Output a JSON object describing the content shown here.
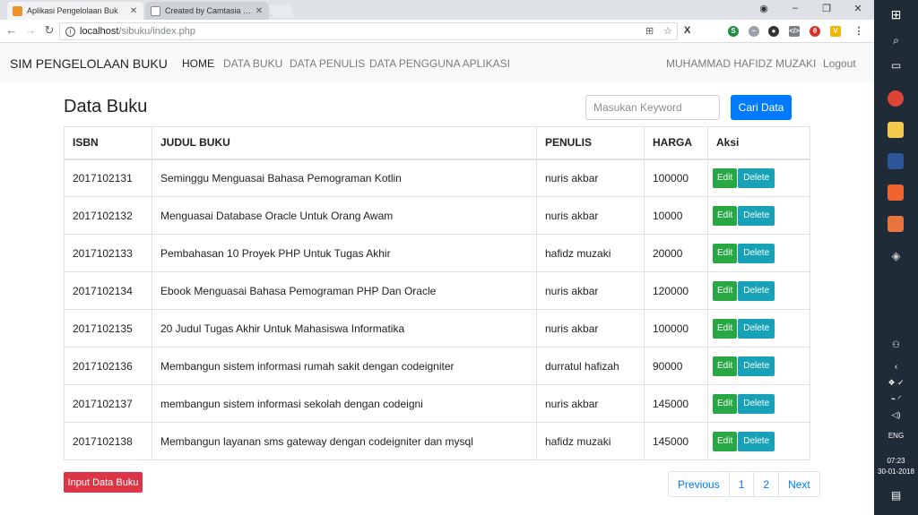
{
  "browser": {
    "tabs": [
      {
        "title": "Aplikasi Pengelolaan Buk",
        "active": true
      },
      {
        "title": "Created by Camtasia Stu",
        "active": false
      }
    ],
    "url_host": "localhost",
    "url_path": "/sibuku/index.php"
  },
  "navbar": {
    "brand": "SIM PENGELOLAAN BUKU",
    "links": [
      "HOME",
      "DATA BUKU",
      "DATA PENULIS",
      "DATA PENGGUNA APLIKASI"
    ],
    "user": "MUHAMMAD HAFIDZ MUZAKI",
    "logout": "Logout"
  },
  "main": {
    "heading": "Data Buku",
    "search_placeholder": "Masukan Keyword",
    "search_button": "Cari Data",
    "input_button": "Input Data Buku"
  },
  "table": {
    "headers": [
      "ISBN",
      "JUDUL BUKU",
      "PENULIS",
      "HARGA",
      "Aksi"
    ],
    "rows": [
      {
        "isbn": "2017102131",
        "judul": "Seminggu Menguasai Bahasa Pemograman Kotlin",
        "penulis": "nuris akbar",
        "harga": "100000"
      },
      {
        "isbn": "2017102132",
        "judul": "Menguasai Database Oracle Untuk Orang Awam",
        "penulis": "nuris akbar",
        "harga": "10000"
      },
      {
        "isbn": "2017102133",
        "judul": "Pembahasan 10 Proyek PHP Untuk Tugas Akhir",
        "penulis": "hafidz muzaki",
        "harga": "20000"
      },
      {
        "isbn": "2017102134",
        "judul": "Ebook Menguasai Bahasa Pemograman PHP Dan Oracle",
        "penulis": "nuris akbar",
        "harga": "120000"
      },
      {
        "isbn": "2017102135",
        "judul": "20 Judul Tugas Akhir Untuk Mahasiswa Informatika",
        "penulis": "nuris akbar",
        "harga": "100000"
      },
      {
        "isbn": "2017102136",
        "judul": "Membangun sistem informasi rumah sakit dengan codeigniter",
        "penulis": "durratul hafizah",
        "harga": "90000"
      },
      {
        "isbn": "2017102137",
        "judul": "membangun sistem informasi sekolah dengan codeigni",
        "penulis": "nuris akbar",
        "harga": "145000"
      },
      {
        "isbn": "2017102138",
        "judul": "Membangun layanan sms gateway dengan codeigniter dan mysql",
        "penulis": "hafidz muzaki",
        "harga": "145000"
      }
    ],
    "edit_label": "Edit",
    "delete_label": "Delete"
  },
  "pagination": [
    "Previous",
    "1",
    "2",
    "Next"
  ],
  "taskbar": {
    "language": "ENG",
    "time": "07:23",
    "date": "30-01-2018"
  },
  "colors": {
    "primary": "#007bff",
    "success": "#28a745",
    "info": "#17a2b8",
    "danger": "#dc3545"
  }
}
